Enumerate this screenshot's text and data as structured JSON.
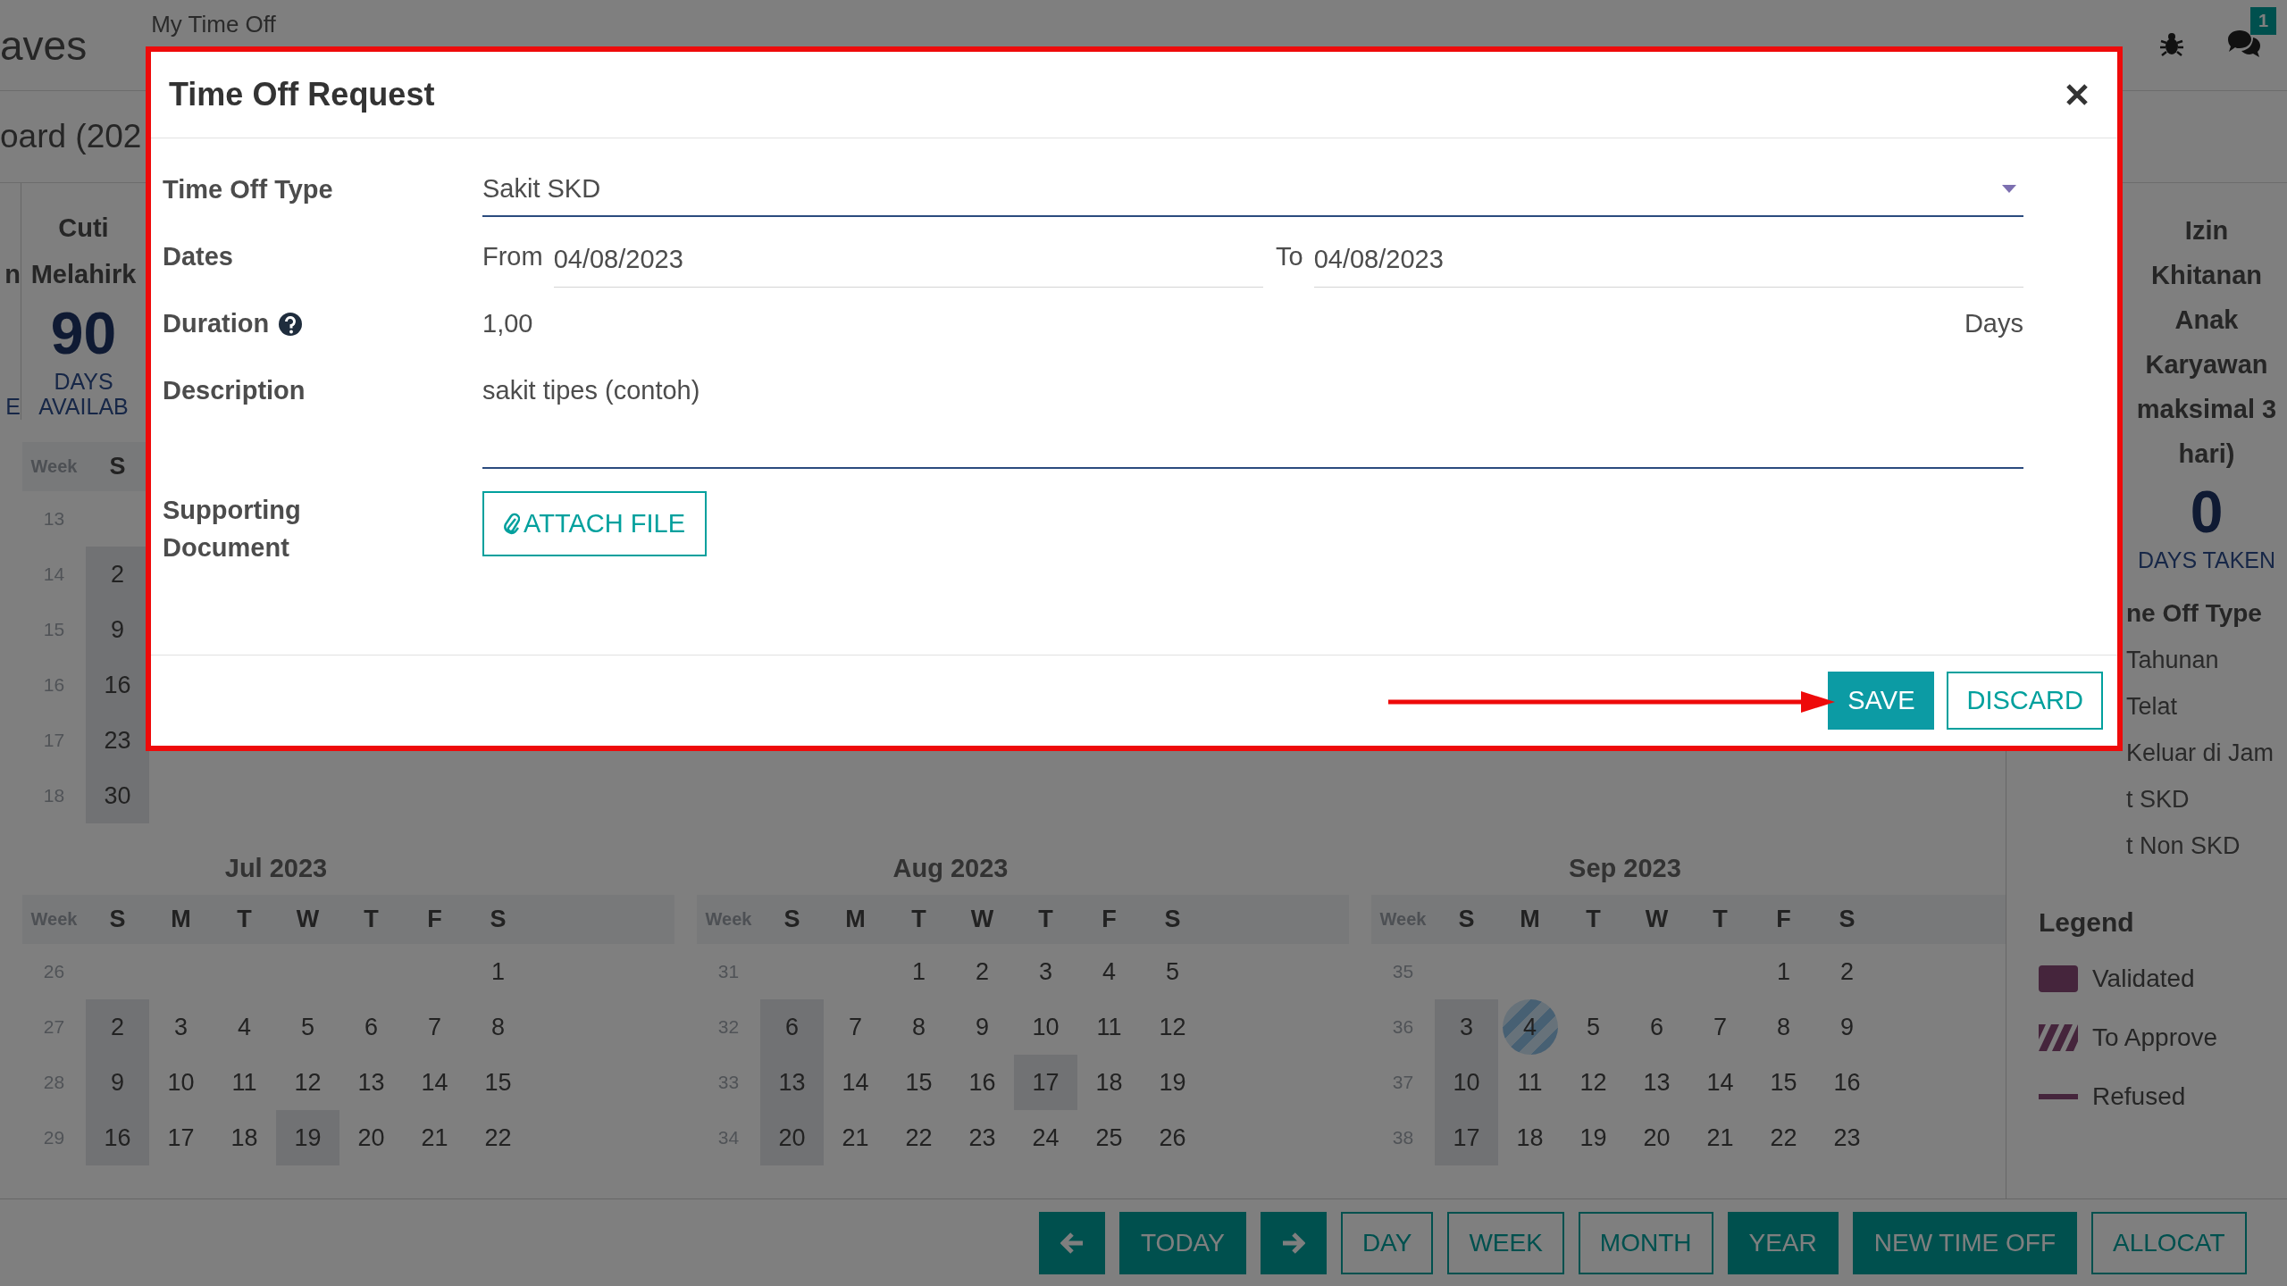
{
  "navbar": {
    "app_name": "aves",
    "menu": [
      "My Time Off"
    ],
    "messages_badge": "1"
  },
  "breadcrumb": "oard (202",
  "summary_cards": [
    {
      "title_lines": [
        "n"
      ],
      "label": "E"
    },
    {
      "title_lines": [
        "Cuti",
        "Melahirk"
      ],
      "number": "90",
      "unit": "DAYS",
      "label": "AVAILAB"
    }
  ],
  "calendar_rows": [
    [
      {
        "week_label": "Week",
        "weekdays": [
          "S"
        ],
        "weeks": [
          {
            "week": "13"
          },
          {
            "week": "14",
            "days": [
              "2"
            ]
          },
          {
            "week": "15",
            "days": [
              "9"
            ]
          },
          {
            "week": "16",
            "days": [
              "16"
            ]
          },
          {
            "week": "17",
            "days": [
              "23"
            ]
          },
          {
            "week": "18",
            "days": [
              "30"
            ]
          }
        ]
      }
    ],
    [
      {
        "title": "Jul 2023",
        "week_label": "Week",
        "weekdays": [
          "S",
          "M",
          "T",
          "W",
          "T",
          "F",
          "S"
        ],
        "weeks": [
          {
            "week": "26",
            "days": [
              "1"
            ]
          },
          {
            "week": "27",
            "days": [
              "2",
              "3",
              "4",
              "5",
              "6",
              "7",
              "8"
            ]
          },
          {
            "week": "28",
            "days": [
              "9",
              "10",
              "11",
              "12",
              "13",
              "14",
              "15"
            ]
          },
          {
            "week": "29",
            "days": [
              "16",
              "17",
              "18",
              {
                "day": "19",
                "kind": "holiday"
              },
              "20",
              "21",
              "22"
            ]
          }
        ]
      },
      {
        "title": "Aug 2023",
        "week_label": "Week",
        "weekdays": [
          "S",
          "M",
          "T",
          "W",
          "T",
          "F",
          "S"
        ],
        "weeks": [
          {
            "week": "31",
            "days": [
              "1",
              "2",
              "3",
              "4",
              "5"
            ]
          },
          {
            "week": "32",
            "days": [
              "6",
              "7",
              "8",
              "9",
              "10",
              "11",
              "12"
            ]
          },
          {
            "week": "33",
            "days": [
              "13",
              "14",
              "15",
              "16",
              {
                "day": "17",
                "kind": "holiday"
              },
              "18",
              "19"
            ]
          },
          {
            "week": "34",
            "days": [
              "20",
              "21",
              "22",
              "23",
              "24",
              "25",
              "26"
            ]
          }
        ]
      },
      {
        "title": "Sep 2023",
        "week_label": "Week",
        "weekdays": [
          "S",
          "M",
          "T",
          "W",
          "T",
          "F",
          "S"
        ],
        "weeks": [
          {
            "week": "35",
            "days": [
              "1",
              "2"
            ]
          },
          {
            "week": "36",
            "days": [
              "3",
              {
                "day": "4",
                "kind": "to_approve"
              },
              "5",
              "6",
              "7",
              "8",
              "9"
            ]
          },
          {
            "week": "37",
            "days": [
              "10",
              "11",
              "12",
              "13",
              "14",
              "15",
              "16"
            ]
          },
          {
            "week": "38",
            "days": [
              "17",
              "18",
              "19",
              "20",
              "21",
              "22",
              "23"
            ]
          }
        ]
      }
    ]
  ],
  "time_off_card": {
    "title_lines": [
      "Izin",
      "Khitanan",
      "Anak",
      "Karyawan",
      "maksimal 3",
      "hari)"
    ],
    "number": "0",
    "label": "DAYS TAKEN"
  },
  "time_off_types": {
    "title": "ne Off Type",
    "items": [
      "Tahunan",
      "Telat",
      "Keluar di Jam",
      "t SKD",
      "t Non SKD"
    ]
  },
  "legend": {
    "title": "Legend",
    "items": [
      {
        "label": "Validated",
        "kind": "validated"
      },
      {
        "label": "To Approve",
        "kind": "to_approve"
      },
      {
        "label": "Refused",
        "kind": "refused"
      }
    ]
  },
  "bottom_bar": {
    "navigation": [
      {
        "kind": "previous"
      },
      {
        "kind": "today",
        "label": "TODAY"
      },
      {
        "kind": "next"
      }
    ],
    "views": [
      {
        "label": "DAY",
        "selected": false
      },
      {
        "label": "WEEK",
        "selected": false
      },
      {
        "label": "MONTH",
        "selected": false
      },
      {
        "label": "YEAR",
        "selected": true
      }
    ],
    "actions": [
      {
        "kind": "new",
        "label": "NEW TIME OFF"
      },
      {
        "kind": "allocate",
        "label": "ALLOCAT"
      }
    ]
  },
  "dialog": {
    "title": "Time Off Request",
    "fields": [
      {
        "kind": "select",
        "label": "Time Off Type",
        "value": "Sakit SKD"
      },
      {
        "kind": "daterange",
        "label": "Dates",
        "from_label": "From",
        "from": "04/08/2023",
        "to_label": "To",
        "to": "04/08/2023"
      },
      {
        "kind": "number",
        "label": "Duration",
        "help": true,
        "value": "1,00",
        "unit": "Days"
      },
      {
        "kind": "textarea",
        "label": "Description",
        "value": "sakit tipes (contoh)"
      },
      {
        "kind": "attachment",
        "label": "Supporting Document",
        "button": "ATTACH FILE"
      }
    ],
    "buttons": [
      {
        "kind": "save",
        "label": "SAVE"
      },
      {
        "kind": "discard",
        "label": "DISCARD"
      }
    ]
  }
}
